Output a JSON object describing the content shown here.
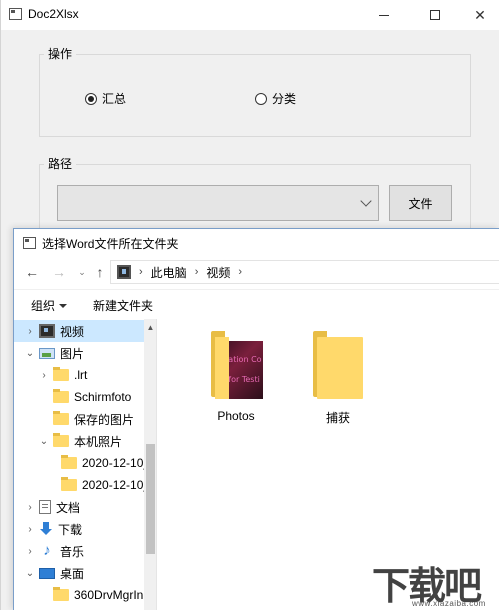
{
  "window": {
    "title": "Doc2Xlsx"
  },
  "operation_group": {
    "label": "操作",
    "options": [
      {
        "label": "汇总",
        "selected": true
      },
      {
        "label": "分类",
        "selected": false
      }
    ]
  },
  "path_group": {
    "label": "路径",
    "combo_value": "",
    "file_button": "文件"
  },
  "dialog": {
    "title": "选择Word文件所在文件夹",
    "breadcrumb": [
      "此电脑",
      "视频"
    ],
    "toolbar": {
      "organize": "组织",
      "new_folder": "新建文件夹"
    },
    "tree": [
      {
        "label": "视频",
        "icon": "video-folder-icon",
        "expander": "›",
        "selected": true
      },
      {
        "label": "图片",
        "icon": "pictures-folder-icon",
        "expander": "⌄",
        "selected": false
      },
      {
        "label": ".lrt",
        "icon": "folder-icon",
        "expander": "›",
        "selected": false
      },
      {
        "label": "Schirmfoto",
        "icon": "folder-icon",
        "expander": "",
        "selected": false
      },
      {
        "label": "保存的图片",
        "icon": "folder-icon",
        "expander": "",
        "selected": false
      },
      {
        "label": "本机照片",
        "icon": "folder-icon",
        "expander": "⌄",
        "selected": false
      },
      {
        "label": "2020-12-10_",
        "icon": "folder-icon",
        "expander": "",
        "selected": false
      },
      {
        "label": "2020-12-10_",
        "icon": "folder-icon",
        "expander": "",
        "selected": false
      },
      {
        "label": "文档",
        "icon": "documents-icon",
        "expander": "›",
        "selected": false
      },
      {
        "label": "下载",
        "icon": "download-icon",
        "expander": "›",
        "selected": false
      },
      {
        "label": "音乐",
        "icon": "music-icon",
        "expander": "›",
        "selected": false
      },
      {
        "label": "桌面",
        "icon": "desktop-icon",
        "expander": "⌄",
        "selected": false
      },
      {
        "label": "360DrvMgrIn",
        "icon": "folder-icon",
        "expander": "",
        "selected": false
      }
    ],
    "items": [
      {
        "label": "Photos",
        "thumbnail_lines": [
          "luation Co",
          "y for Testi"
        ]
      },
      {
        "label": "捕获"
      }
    ]
  },
  "watermark": {
    "logo": "下载吧",
    "url": "www.xiazaiba.com"
  },
  "colors": {
    "selection": "#cce8ff",
    "folder": "#ffd96b",
    "accent": "#2f7fd5"
  }
}
